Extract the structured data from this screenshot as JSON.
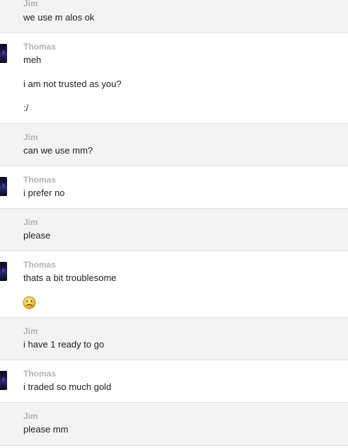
{
  "messages": [
    {
      "sender": "Jim",
      "lines": [
        "we use m alos ok"
      ]
    },
    {
      "sender": "Thomas",
      "lines": [
        "meh",
        "i am not trusted as you?",
        ":/"
      ]
    },
    {
      "sender": "Jim",
      "lines": [
        "can we use mm?"
      ]
    },
    {
      "sender": "Thomas",
      "lines": [
        "i prefer no"
      ]
    },
    {
      "sender": "Jim",
      "lines": [
        "please"
      ]
    },
    {
      "sender": "Thomas",
      "lines": [
        "thats a bit troublesome"
      ],
      "emoticon": "worried-face-icon"
    },
    {
      "sender": "Jim",
      "lines": [
        "i have 1 ready to go"
      ]
    },
    {
      "sender": "Thomas",
      "lines": [
        "i traded so much gold"
      ]
    },
    {
      "sender": "Jim",
      "lines": [
        "please mm"
      ]
    }
  ],
  "colors": {
    "jim_bg": "#f3f3f3",
    "thomas_bg": "#ffffff",
    "sender_name": "#b3b3b3",
    "message_text": "#222222",
    "divider": "#e2e2e2"
  }
}
